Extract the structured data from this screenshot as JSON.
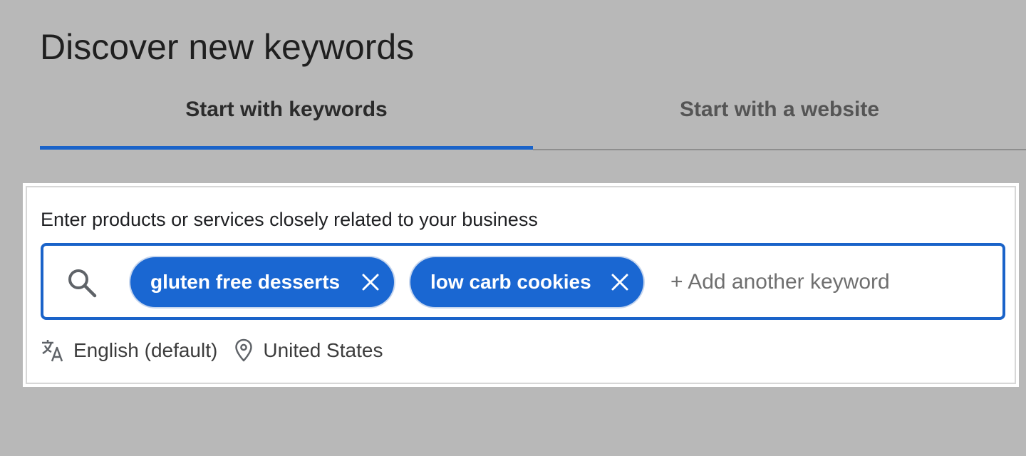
{
  "page": {
    "title": "Discover new keywords"
  },
  "tabs": [
    {
      "label": "Start with keywords",
      "active": true
    },
    {
      "label": "Start with a website",
      "active": false
    }
  ],
  "card": {
    "label": "Enter products or services closely related to your business",
    "search_icon": "search-icon",
    "chips": [
      {
        "label": "gluten free desserts",
        "icon": "close-icon"
      },
      {
        "label": "low carb cookies",
        "icon": "close-icon"
      }
    ],
    "add_keyword_placeholder": "+ Add another keyword",
    "language": {
      "icon": "translate-icon",
      "label": "English (default)"
    },
    "location": {
      "icon": "location-pin-icon",
      "label": "United States"
    }
  },
  "colors": {
    "background": "#b8b8b8",
    "accent": "#1a63c9",
    "chip": "#1a67d2",
    "card": "#ffffff"
  }
}
